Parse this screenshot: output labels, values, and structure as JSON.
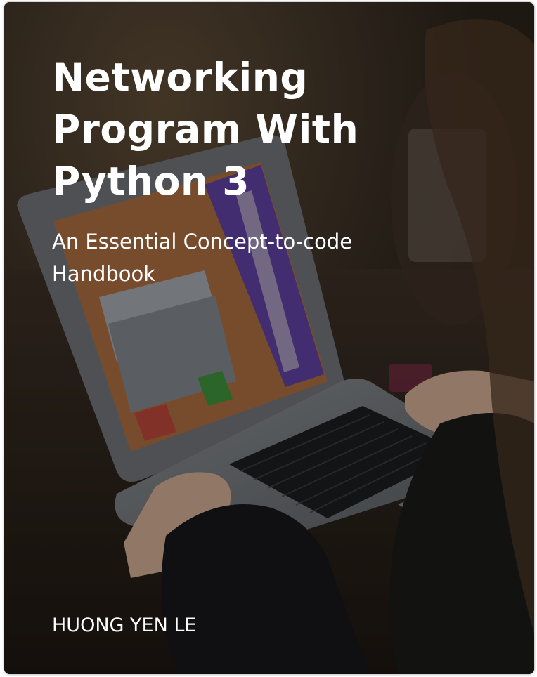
{
  "book": {
    "title": "Networking\nProgram With\nPython 3",
    "subtitle": "An Essential Concept-to-code\nHandbook",
    "author": "HUONG YEN LE"
  },
  "cover_image": {
    "subject": "laptop-keyboard-photo",
    "overlay_color": "#000000"
  }
}
